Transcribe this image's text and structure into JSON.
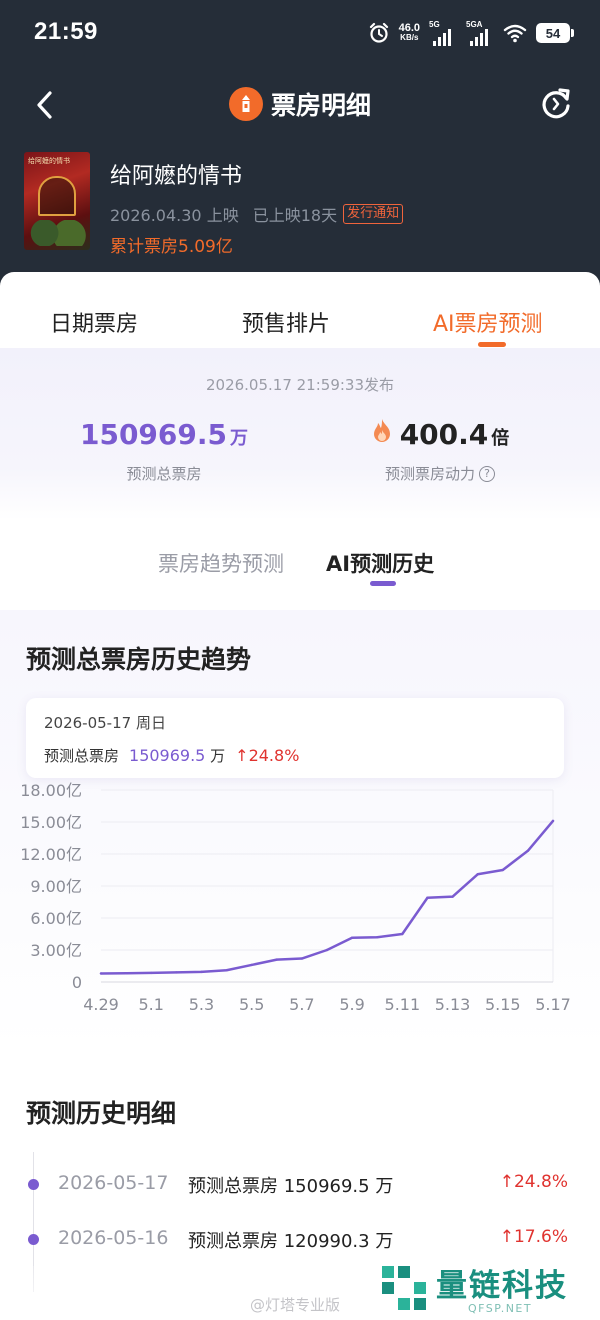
{
  "status_bar": {
    "time": "21:59",
    "net_speed": "46.0",
    "net_unit": "KB/s",
    "sim1": "5G",
    "sim2": "5GA",
    "battery": "54",
    "icons": [
      "alarm-icon",
      "signal-icon",
      "wifi-icon",
      "battery-icon"
    ]
  },
  "nav": {
    "title": "票房明细",
    "icons": [
      "back-icon",
      "logo-icon",
      "refresh-icon"
    ]
  },
  "movie": {
    "name": "给阿嬷的情书",
    "poster_title": "给阿嬷的情书",
    "release_date": "2026.04.30 上映",
    "days_on": "已上映18天",
    "release_notice": "发行通知",
    "total_box": "累计票房5.09亿"
  },
  "tabs": [
    {
      "label": "日期票房",
      "active": false
    },
    {
      "label": "预售排片",
      "active": false
    },
    {
      "label": "AI票房预测",
      "active": true
    }
  ],
  "prediction": {
    "published": "2026.05.17 21:59:33发布",
    "total_value": "150969.5",
    "total_unit": "万",
    "total_label": "预测总票房",
    "power_value": "400.4",
    "power_unit": "倍",
    "power_label": "预测票房动力",
    "help": "?"
  },
  "subtabs": [
    {
      "label": "票房趋势预测",
      "active": false
    },
    {
      "label": "AI预测历史",
      "active": true
    }
  ],
  "chart_section": {
    "title": "预测总票房历史趋势",
    "tooltip": {
      "date": "2026-05-17  周日",
      "label": "预测总票房",
      "value": "150969.5",
      "unit": "万",
      "change": "24.8%"
    }
  },
  "chart_data": {
    "type": "line",
    "title": "预测总票房历史趋势",
    "x": [
      "4.29",
      "4.30",
      "5.1",
      "5.2",
      "5.3",
      "5.4",
      "5.5",
      "5.6",
      "5.7",
      "5.8",
      "5.9",
      "5.10",
      "5.11",
      "5.12",
      "5.13",
      "5.14",
      "5.15",
      "5.16",
      "5.17"
    ],
    "xtick_labels": [
      "4.29",
      "5.1",
      "5.3",
      "5.5",
      "5.7",
      "5.9",
      "5.11",
      "5.13",
      "5.15",
      "5.17"
    ],
    "series": [
      {
        "values": [
          0.8,
          0.82,
          0.85,
          0.9,
          0.95,
          1.1,
          1.6,
          2.1,
          2.2,
          3.0,
          4.15,
          4.2,
          4.5,
          7.9,
          8.0,
          10.1,
          10.5,
          12.3,
          15.1
        ]
      }
    ],
    "yticks": [
      0,
      3,
      6,
      9,
      12,
      15,
      18
    ],
    "ytick_labels": [
      "0",
      "3.00亿",
      "6.00亿",
      "9.00亿",
      "12.00亿",
      "15.00亿",
      "18.00亿"
    ],
    "ylim": [
      0,
      18
    ],
    "grid": true,
    "color": "#7a5bd0"
  },
  "history": {
    "title": "预测历史明细",
    "items": [
      {
        "date": "2026-05-17",
        "text": "预测总票房 150969.5 万",
        "change": "24.8%"
      },
      {
        "date": "2026-05-16",
        "text": "预测总票房 120990.3 万",
        "change": "17.6%"
      }
    ]
  },
  "watermarks": {
    "weibo": "@灯塔专业版",
    "brand": "量链科技",
    "brand_url": "QFSP.NET"
  },
  "colors": {
    "header_bg": "#252d38",
    "accent": "#f26b2a",
    "purple": "#7a5bd0",
    "up_red": "#e0332f"
  }
}
